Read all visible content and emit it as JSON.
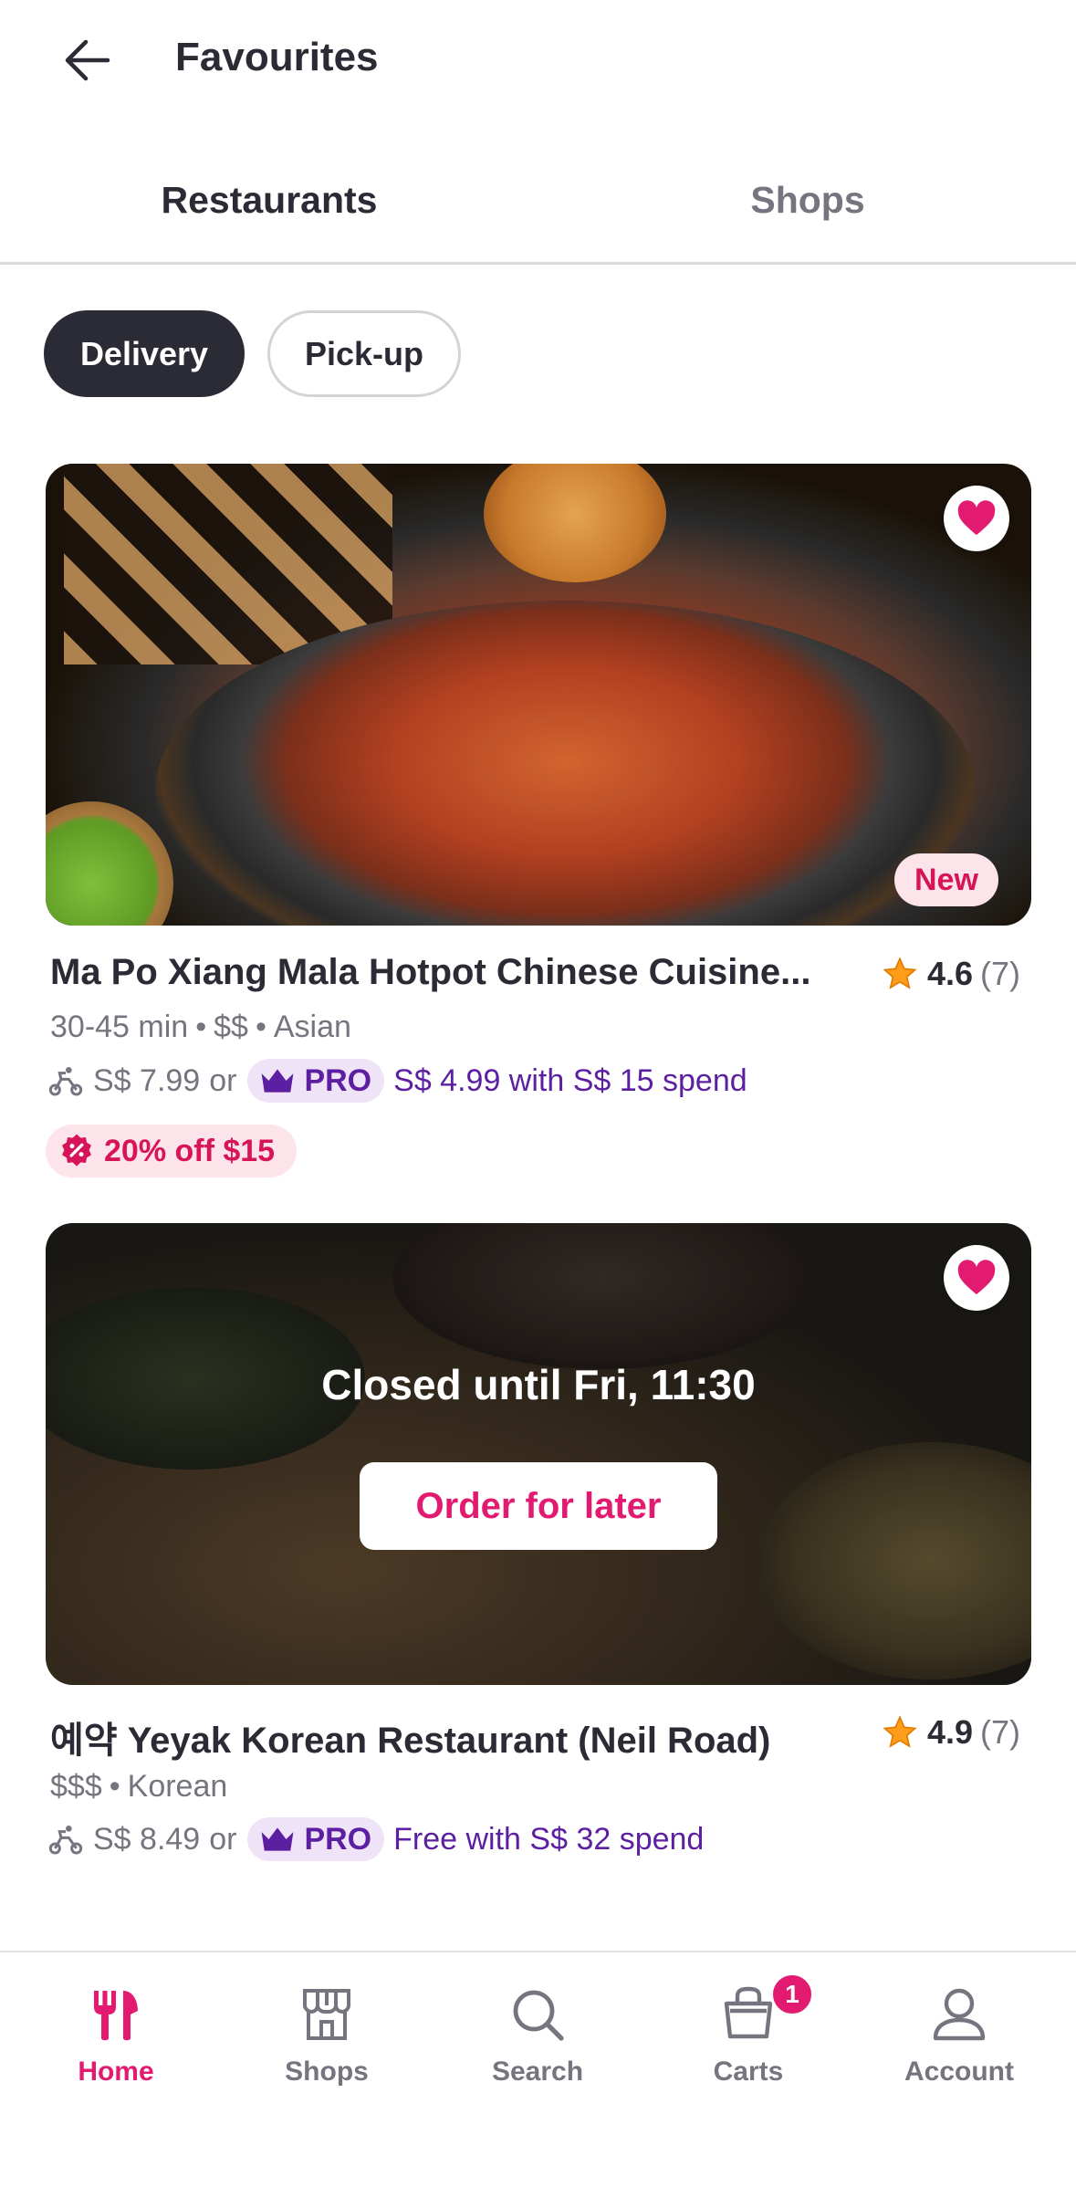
{
  "header": {
    "title": "Favourites"
  },
  "tabs": [
    {
      "label": "Restaurants",
      "active": true
    },
    {
      "label": "Shops",
      "active": false
    }
  ],
  "filters": [
    {
      "label": "Delivery",
      "selected": true
    },
    {
      "label": "Pick-up",
      "selected": false
    }
  ],
  "restaurants": [
    {
      "name": "Ma Po Xiang Mala Hotpot Chinese Cuisine...",
      "badge": "New",
      "rating": "4.6",
      "rating_count": "(7)",
      "meta": [
        "30-45 min",
        "$$",
        "Asian"
      ],
      "delivery_fee": "S$ 7.99",
      "or_text": "or",
      "pro_label": "PRO",
      "pro_offer": "S$ 4.99 with S$ 15 spend",
      "promo": "20% off $15",
      "favourited": true
    },
    {
      "name": "예약 Yeyak Korean Restaurant (Neil Road)",
      "status": "Closed until Fri, 11:30",
      "action": "Order for later",
      "rating": "4.9",
      "rating_count": "(7)",
      "meta": [
        "$$$",
        "Korean"
      ],
      "delivery_fee": "S$ 8.49",
      "or_text": "or",
      "pro_label": "PRO",
      "pro_offer": "Free with S$ 32 spend",
      "favourited": true
    }
  ],
  "bottom_nav": [
    {
      "label": "Home",
      "icon": "cutlery-icon",
      "active": true
    },
    {
      "label": "Shops",
      "icon": "store-icon",
      "active": false
    },
    {
      "label": "Search",
      "icon": "search-icon",
      "active": false
    },
    {
      "label": "Carts",
      "icon": "cart-icon",
      "active": false,
      "badge": "1"
    },
    {
      "label": "Account",
      "icon": "user-icon",
      "active": false
    }
  ],
  "colors": {
    "brand": "#e21b70",
    "pro": "#5c1fa1",
    "text": "#2b2b36",
    "muted": "#75757f"
  }
}
